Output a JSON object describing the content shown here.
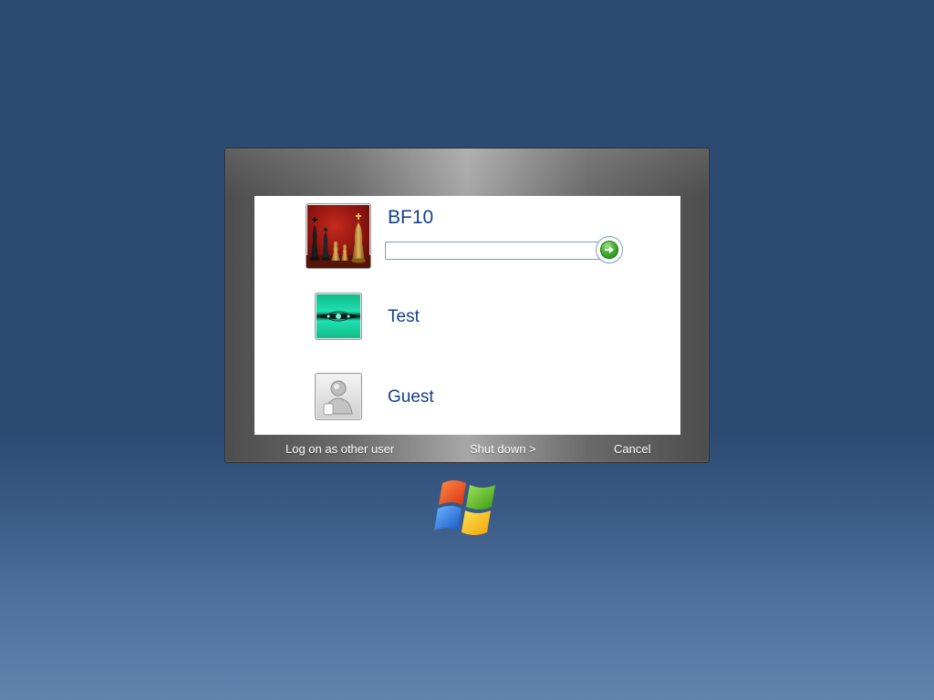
{
  "users": [
    {
      "name": "BF10",
      "selected": true,
      "picture": "chess-pieces-picture"
    },
    {
      "name": "Test",
      "selected": false,
      "picture": "teal-abstract-picture"
    },
    {
      "name": "Guest",
      "selected": false,
      "picture": "guest-user-picture"
    }
  ],
  "password": {
    "value": "",
    "placeholder": ""
  },
  "go_button": {
    "icon": "right-arrow-icon"
  },
  "footer": {
    "other_user_label": "Log on as other user",
    "shutdown_label": "Shut down >",
    "cancel_label": "Cancel"
  },
  "logo": {
    "icon": "windows-flag-logo"
  },
  "colors": {
    "background_top": "#2c4a72",
    "background_bottom": "#6283ae",
    "username_text": "#153f8a",
    "go_button_green": "#3fae2f",
    "input_border": "#7b9ebd"
  }
}
